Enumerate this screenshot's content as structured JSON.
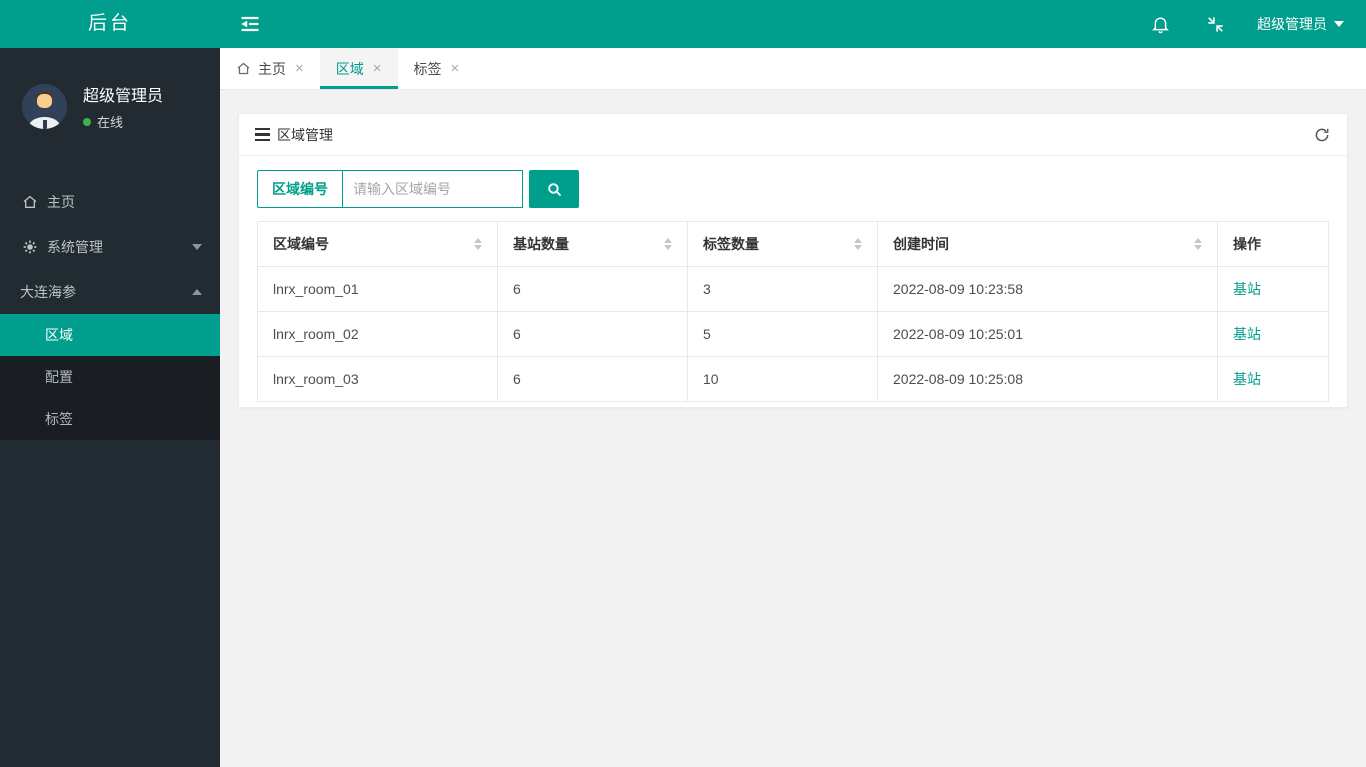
{
  "colors": {
    "accent": "#009e8c",
    "sidebar_bg": "#232b32",
    "submenu_bg": "#1a1e22",
    "content_bg": "#f2f2f2",
    "online_green": "#39b54a"
  },
  "topbar": {
    "logo": "后台",
    "user_menu": "超级管理员",
    "icons": [
      "menu-fold-icon",
      "bell-icon",
      "fullscreen-exit-icon",
      "caret-down-icon"
    ]
  },
  "sidebar": {
    "user": {
      "name": "超级管理员",
      "status": "在线"
    },
    "menu": [
      {
        "label": "主页",
        "icon": "home-icon"
      },
      {
        "label": "系统管理",
        "icon": "gear-icon",
        "chevron": "down"
      },
      {
        "label": "大连海参",
        "chevron": "up",
        "children": [
          {
            "label": "区域",
            "active": true
          },
          {
            "label": "配置",
            "active": false
          },
          {
            "label": "标签",
            "active": false
          }
        ]
      }
    ]
  },
  "tabs": {
    "close_glyph": "×",
    "items": [
      {
        "label": "主页",
        "icon": "home-icon",
        "active": false
      },
      {
        "label": "区域",
        "active": true
      },
      {
        "label": "标签",
        "active": false
      }
    ]
  },
  "panel": {
    "title": "区域管理",
    "header_icons": [
      "list-icon",
      "refresh-icon"
    ],
    "search": {
      "label": "区域编号",
      "placeholder": "请输入区域编号",
      "button_icon": "search-icon"
    },
    "table": {
      "columns": [
        {
          "label": "区域编号",
          "sortable": true
        },
        {
          "label": "基站数量",
          "sortable": true
        },
        {
          "label": "标签数量",
          "sortable": true
        },
        {
          "label": "创建时间",
          "sortable": true
        },
        {
          "label": "操作",
          "sortable": false
        }
      ],
      "rows": [
        {
          "area_id": "lnrx_room_01",
          "stations": "6",
          "tags": "3",
          "created": "2022-08-09 10:23:58",
          "action": "基站"
        },
        {
          "area_id": "lnrx_room_02",
          "stations": "6",
          "tags": "5",
          "created": "2022-08-09 10:25:01",
          "action": "基站"
        },
        {
          "area_id": "lnrx_room_03",
          "stations": "6",
          "tags": "10",
          "created": "2022-08-09 10:25:08",
          "action": "基站"
        }
      ]
    }
  }
}
